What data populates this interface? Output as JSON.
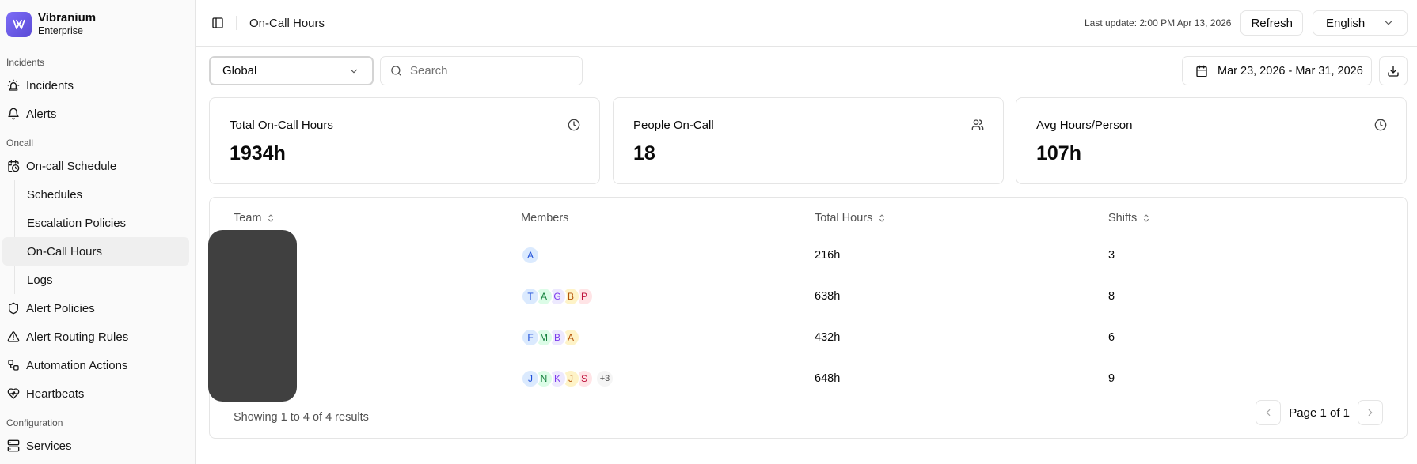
{
  "brand": {
    "name": "Vibranium",
    "subtitle": "Enterprise"
  },
  "sidebar": {
    "sections": [
      {
        "label": "Incidents",
        "items": [
          {
            "label": "Incidents",
            "icon": "siren-icon"
          },
          {
            "label": "Alerts",
            "icon": "bell-icon"
          }
        ]
      },
      {
        "label": "Oncall",
        "items": [
          {
            "label": "On-call Schedule",
            "icon": "calendar-clock-icon",
            "children": [
              {
                "label": "Schedules"
              },
              {
                "label": "Escalation Policies"
              },
              {
                "label": "On-Call Hours",
                "active": true
              },
              {
                "label": "Logs"
              }
            ]
          },
          {
            "label": "Alert Policies",
            "icon": "shield-icon"
          },
          {
            "label": "Alert Routing Rules",
            "icon": "triangle-alert-icon"
          },
          {
            "label": "Automation Actions",
            "icon": "workflow-icon"
          },
          {
            "label": "Heartbeats",
            "icon": "heart-pulse-icon"
          }
        ]
      },
      {
        "label": "Configuration",
        "items": [
          {
            "label": "Services",
            "icon": "server-icon"
          }
        ]
      }
    ]
  },
  "header": {
    "title": "On-Call Hours",
    "last_update": "Last update: 2:00 PM Apr 13, 2026",
    "refresh_label": "Refresh",
    "language": "English"
  },
  "toolbar": {
    "scope": "Global",
    "search_placeholder": "Search",
    "date_range": "Mar 23, 2026 - Mar 31, 2026"
  },
  "stats": [
    {
      "title": "Total On-Call Hours",
      "value": "1934h",
      "icon": "clock-icon"
    },
    {
      "title": "People On-Call",
      "value": "18",
      "icon": "users-icon"
    },
    {
      "title": "Avg Hours/Person",
      "value": "107h",
      "icon": "clock-icon"
    }
  ],
  "table": {
    "columns": [
      "Team",
      "Members",
      "Total Hours",
      "Shifts"
    ],
    "rows": [
      {
        "members": [
          "A"
        ],
        "extra": "",
        "hours": "216h",
        "shifts": "3"
      },
      {
        "members": [
          "T",
          "A",
          "G",
          "B",
          "P"
        ],
        "extra": "",
        "hours": "638h",
        "shifts": "8"
      },
      {
        "members": [
          "F",
          "M",
          "B",
          "A"
        ],
        "extra": "",
        "hours": "432h",
        "shifts": "6"
      },
      {
        "members": [
          "J",
          "N",
          "K",
          "J",
          "S"
        ],
        "extra": "+3",
        "hours": "648h",
        "shifts": "9"
      }
    ],
    "footer": "Showing 1 to 4 of 4 results",
    "page_label": "Page 1 of 1"
  },
  "colors": {
    "accent": "#6d5ce8",
    "avatar_blue": "#dbeafe",
    "avatar_green": "#dcfce7",
    "avatar_purple": "#ede9fe",
    "avatar_amber": "#fef3c7",
    "avatar_rose": "#ffe4e6"
  }
}
